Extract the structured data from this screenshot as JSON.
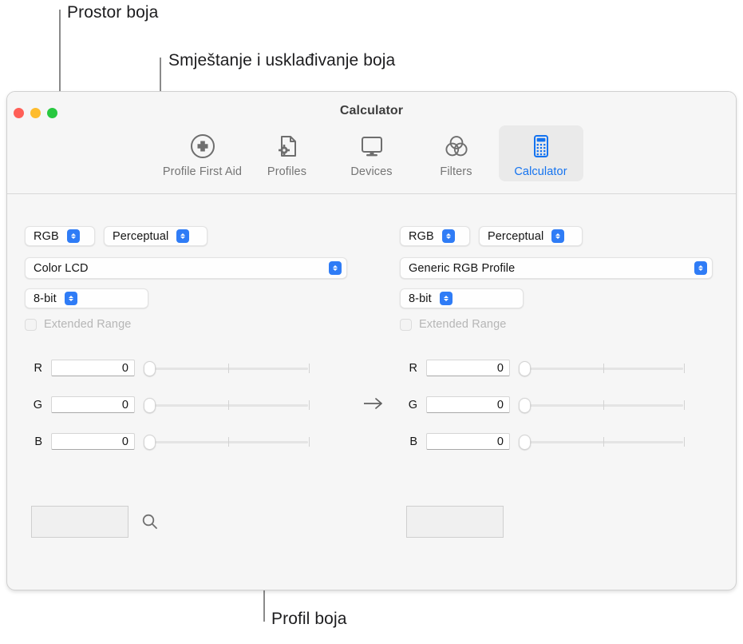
{
  "annotations": [
    {
      "id": "space",
      "label": "Prostor boja"
    },
    {
      "id": "matching",
      "label": "Smještanje i usklađivanje boja"
    },
    {
      "id": "profile",
      "label": "Profil boja"
    }
  ],
  "window": {
    "title": "Calculator",
    "traffic_lights": [
      {
        "name": "close-button",
        "color": "#ff5f57"
      },
      {
        "name": "minimize-button",
        "color": "#febc2e"
      },
      {
        "name": "zoom-button",
        "color": "#28c840"
      }
    ],
    "toolbar": {
      "items": [
        {
          "label": "Profile First Aid",
          "icon": "circle-plus-icon",
          "selected": false
        },
        {
          "label": "Profiles",
          "icon": "document-gear-icon",
          "selected": false
        },
        {
          "label": "Devices",
          "icon": "display-monitor-icon",
          "selected": false
        },
        {
          "label": "Filters",
          "icon": "venn-circles-icon",
          "selected": false
        },
        {
          "label": "Calculator",
          "icon": "calculator-icon",
          "selected": true
        }
      ],
      "selected_accent": "#1473f0"
    }
  },
  "source_panel": {
    "color_space": "RGB",
    "rendering_intent": "Perceptual",
    "color_profile": "Color LCD",
    "bit_depth": "8-bit",
    "extended_range": {
      "label": "Extended Range",
      "checked": false,
      "enabled": false
    },
    "channels": [
      {
        "label": "R",
        "value": "0"
      },
      {
        "label": "G",
        "value": "0"
      },
      {
        "label": "B",
        "value": "0"
      }
    ],
    "swatch_color": "#000000",
    "loupe_icon": "magnifier-icon"
  },
  "destination_panel": {
    "color_space": "RGB",
    "rendering_intent": "Perceptual",
    "color_profile": "Generic RGB Profile",
    "bit_depth": "8-bit",
    "extended_range": {
      "label": "Extended Range",
      "checked": false,
      "enabled": false
    },
    "channels": [
      {
        "label": "R",
        "value": "0"
      },
      {
        "label": "G",
        "value": "0"
      },
      {
        "label": "B",
        "value": "0"
      }
    ],
    "swatch_color": "#000000"
  },
  "conversion_arrow": "→"
}
